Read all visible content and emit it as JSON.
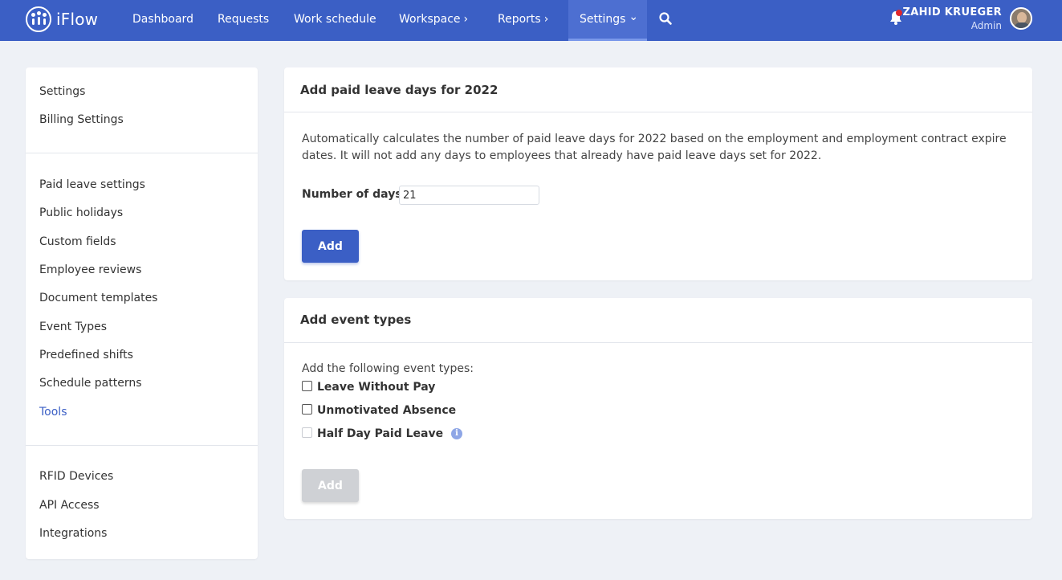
{
  "app": {
    "logo_text": "iFlow"
  },
  "nav": {
    "items": [
      {
        "label": "Dashboard"
      },
      {
        "label": "Requests"
      },
      {
        "label": "Work schedule"
      },
      {
        "label": "Workspace"
      },
      {
        "label": "Reports"
      },
      {
        "label": "Settings"
      }
    ],
    "chevron_right": "›",
    "chevron_down": "⌄",
    "accent_color": "#3b5fc5",
    "notification_dot_color": "#e0262b"
  },
  "user": {
    "name": "ZAHID KRUEGER",
    "role": "Admin"
  },
  "sidebar": {
    "group1": [
      {
        "label": "Settings"
      },
      {
        "label": "Billing Settings"
      }
    ],
    "group2": [
      {
        "label": "Paid leave settings"
      },
      {
        "label": "Public holidays"
      },
      {
        "label": "Custom fields"
      },
      {
        "label": "Employee reviews"
      },
      {
        "label": "Document templates"
      },
      {
        "label": "Event Types"
      },
      {
        "label": "Predefined shifts"
      },
      {
        "label": "Schedule patterns"
      },
      {
        "label": "Tools"
      }
    ],
    "group3": [
      {
        "label": "RFID Devices"
      },
      {
        "label": "API Access"
      },
      {
        "label": "Integrations"
      }
    ]
  },
  "paid_leave_card": {
    "title": "Add paid leave days for 2022",
    "description": "Automatically calculates the number of paid leave days for 2022 based on the employment and employment contract expire dates. It will not add any days to employees that already have paid leave days set for 2022.",
    "days_label": "Number of days:",
    "days_value": "21",
    "add_label": "Add"
  },
  "event_types_card": {
    "title": "Add event types",
    "intro": "Add the following event types:",
    "options": [
      {
        "label": "Leave Without Pay",
        "checked": false,
        "enabled": true
      },
      {
        "label": "Unmotivated Absence",
        "checked": false,
        "enabled": true
      },
      {
        "label": "Half Day Paid Leave",
        "checked": false,
        "enabled": false
      }
    ],
    "info_glyph": "i",
    "add_label": "Add"
  }
}
